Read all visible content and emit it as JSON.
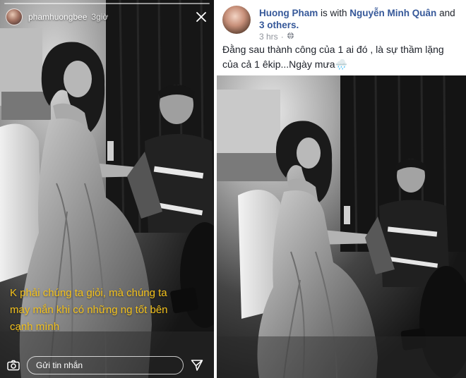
{
  "story": {
    "username": "phamhuongbee",
    "time": "3giờ",
    "caption": "K phải chúng ta giỏi, mà chúng ta may mắn khi có những ng tốt bên cạnh mình",
    "reply_placeholder": "Gửi tin nhắn",
    "icons": {
      "close": "close-icon",
      "camera": "camera-icon",
      "send": "send-icon"
    },
    "caption_color": "#f4c21c"
  },
  "post": {
    "author": "Huong Pham",
    "with_text": "is with",
    "tagged": "Nguyễn Minh Quân",
    "and_text": "and",
    "others": "3 others.",
    "time": "3 hrs",
    "separator": "·",
    "text": "Đằng sau thành công của 1 ai đó , là sự thầm lặng của cả 1 êkip...Ngày mưa🌧️",
    "icons": {
      "privacy": "globe-icon"
    },
    "link_color": "#365899"
  }
}
